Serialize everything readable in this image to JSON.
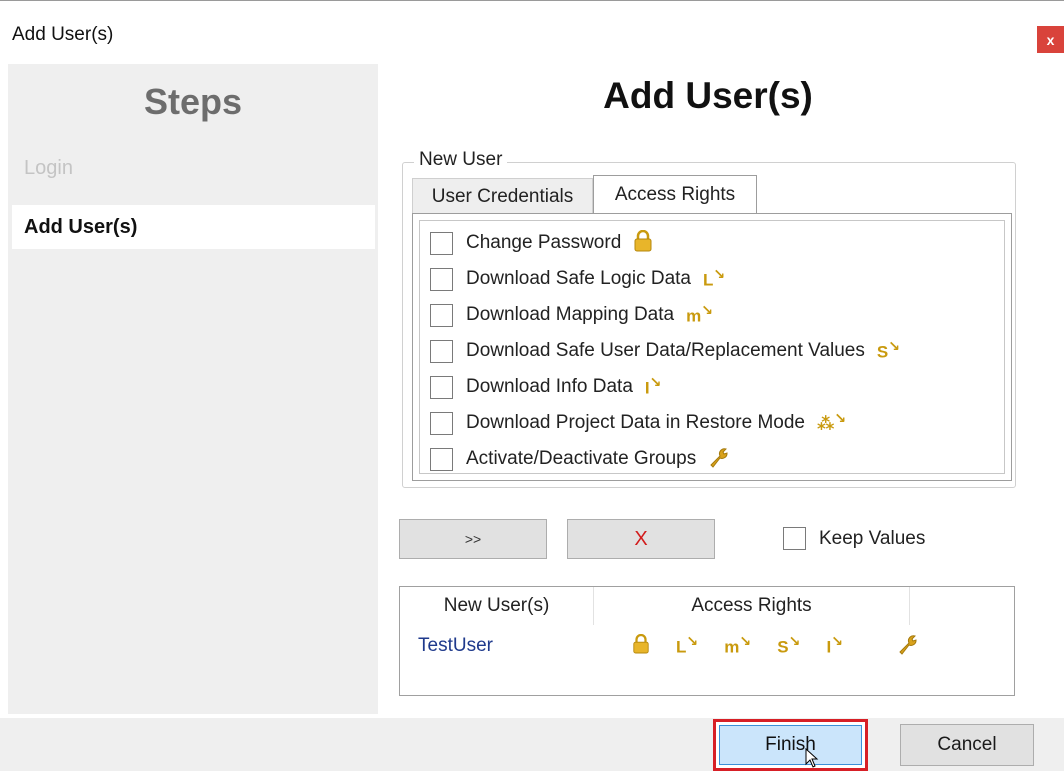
{
  "window": {
    "title": "Add User(s)",
    "close_label": "x"
  },
  "steps": {
    "title": "Steps",
    "items": [
      {
        "label": "Login",
        "state": "done"
      },
      {
        "label": "Add User(s)",
        "state": "active"
      }
    ]
  },
  "main": {
    "title": "Add User(s)",
    "group_label": "New User",
    "tabs": [
      {
        "label": "User Credentials",
        "selected": false
      },
      {
        "label": "Access Rights",
        "selected": true
      }
    ],
    "rights": [
      {
        "label": "Change Password",
        "icon": "lock-icon",
        "checked": false
      },
      {
        "label": "Download Safe Logic Data",
        "icon": "logic-download-icon",
        "checked": false
      },
      {
        "label": "Download Mapping Data",
        "icon": "mapping-download-icon",
        "checked": false
      },
      {
        "label": "Download Safe User Data/Replacement Values",
        "icon": "safe-user-download-icon",
        "checked": false
      },
      {
        "label": "Download Info Data",
        "icon": "info-download-icon",
        "checked": false
      },
      {
        "label": "Download Project Data in Restore Mode",
        "icon": "restore-download-icon",
        "checked": false
      },
      {
        "label": "Activate/Deactivate Groups",
        "icon": "wrench-icon",
        "checked": false
      }
    ],
    "add_button": ">>",
    "clear_button": "X",
    "keep_values": {
      "label": "Keep Values",
      "checked": false
    }
  },
  "users_table": {
    "columns": [
      "New User(s)",
      "Access Rights",
      ""
    ],
    "rows": [
      {
        "user": "TestUser",
        "rights_icons": [
          "lock-icon",
          "logic-download-icon",
          "mapping-download-icon",
          "safe-user-download-icon",
          "info-download-icon",
          "wrench-icon"
        ]
      }
    ]
  },
  "footer": {
    "finish_label": "Finish",
    "cancel_label": "Cancel"
  },
  "colors": {
    "accent_icon": "#c99a0e",
    "close_red": "#d9433b",
    "highlight_red": "#d71f26",
    "user_link": "#1f3a8c"
  }
}
